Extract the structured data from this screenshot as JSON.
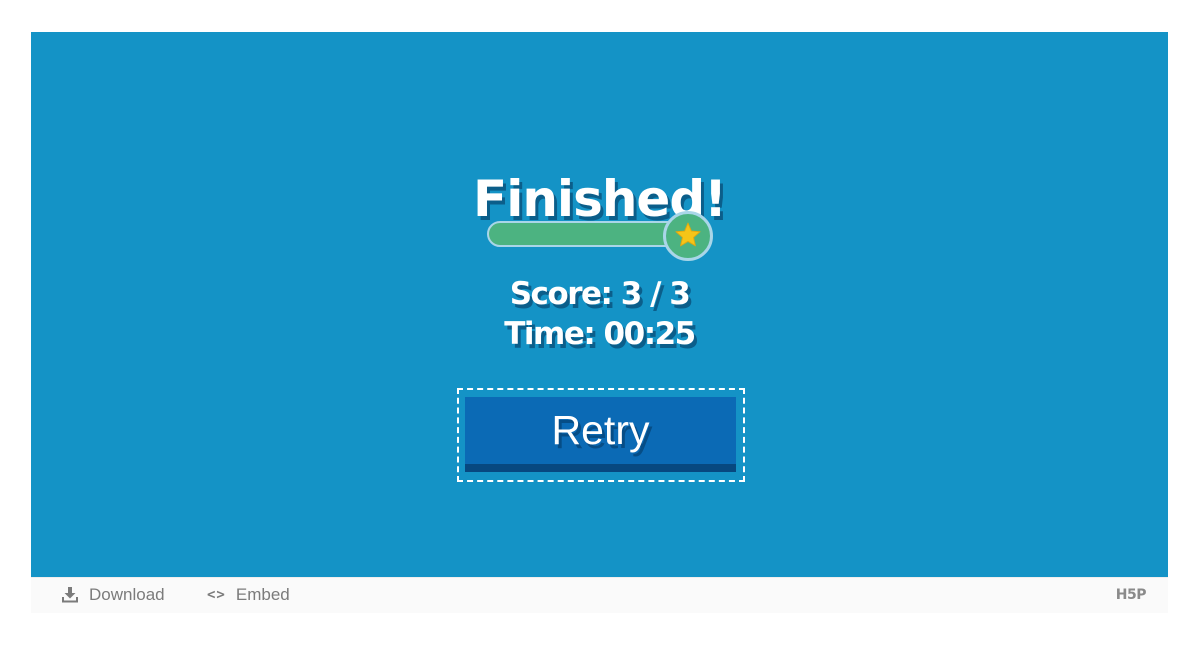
{
  "summary": {
    "title": "Finished!",
    "score_progress": 1.0,
    "score_text": "Score: 3 / 3",
    "time_text": "Time: 00:25",
    "retry_label": "Retry"
  },
  "footer": {
    "download_label": "Download",
    "embed_label": "Embed",
    "embed_icon_glyph": "<>",
    "brand_logo_text": "H5P"
  },
  "colors": {
    "stage_background": "#1493c6",
    "progress_fill": "#4cb381",
    "star": "#f5c518",
    "retry_button": "#0b6ab5",
    "footer_background": "#fafafa"
  },
  "icons": {
    "download": "download-icon",
    "embed": "code-brackets-icon",
    "star": "star-icon"
  }
}
